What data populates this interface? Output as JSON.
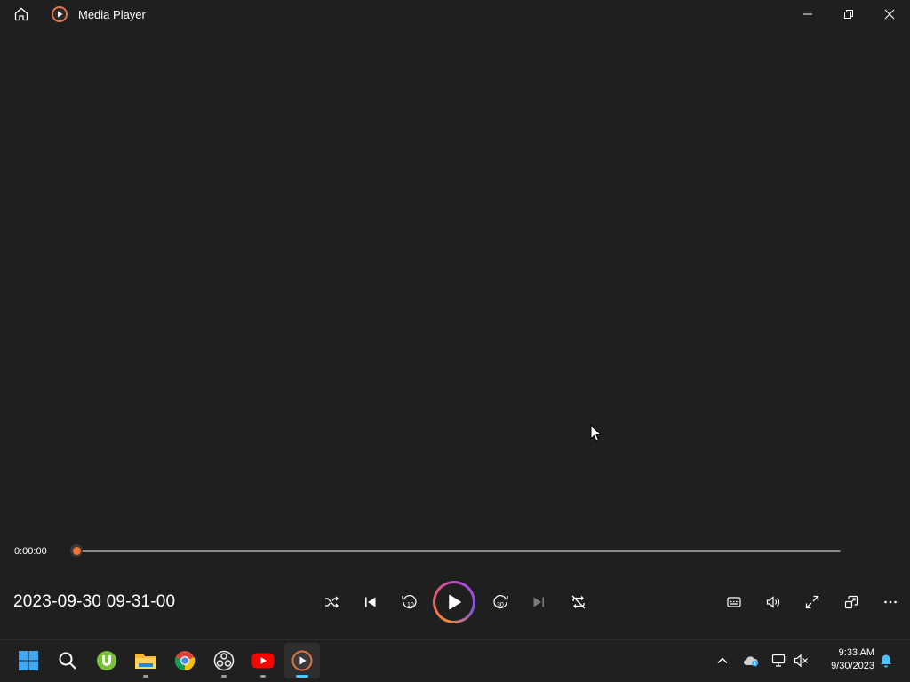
{
  "window": {
    "title": "Media Player",
    "icons": {
      "home": "home-icon",
      "logo": "media-player-logo-icon",
      "minimize": "minimize-icon",
      "maximize": "restore-icon",
      "close": "close-icon"
    }
  },
  "player": {
    "current_time": "0:00:00",
    "progress": 0,
    "media_title": "2023-09-30 09-31-00",
    "controls": [
      "shuffle-icon",
      "previous-icon",
      "rewind-10-icon",
      "play-icon",
      "forward-30-icon",
      "next-icon",
      "repeat-off-icon"
    ],
    "right_controls": [
      "captions-icon",
      "volume-icon",
      "fullscreen-icon",
      "miniplayer-icon",
      "more-icon"
    ],
    "accent_colors": {
      "thumb": "#f0743a",
      "ring_start": "#f08a3a",
      "ring_end": "#7e55e6"
    }
  },
  "taskbar": {
    "apps": [
      "windows-start-icon",
      "search-icon",
      "utorrent-icon",
      "file-explorer-icon",
      "chrome-icon",
      "obs-icon",
      "youtube-icon",
      "media-player-icon"
    ],
    "tray": [
      "chevron-up-icon",
      "onedrive-icon",
      "network-icon",
      "volume-muted-icon"
    ],
    "time": "9:33 AM",
    "date": "9/30/2023"
  }
}
